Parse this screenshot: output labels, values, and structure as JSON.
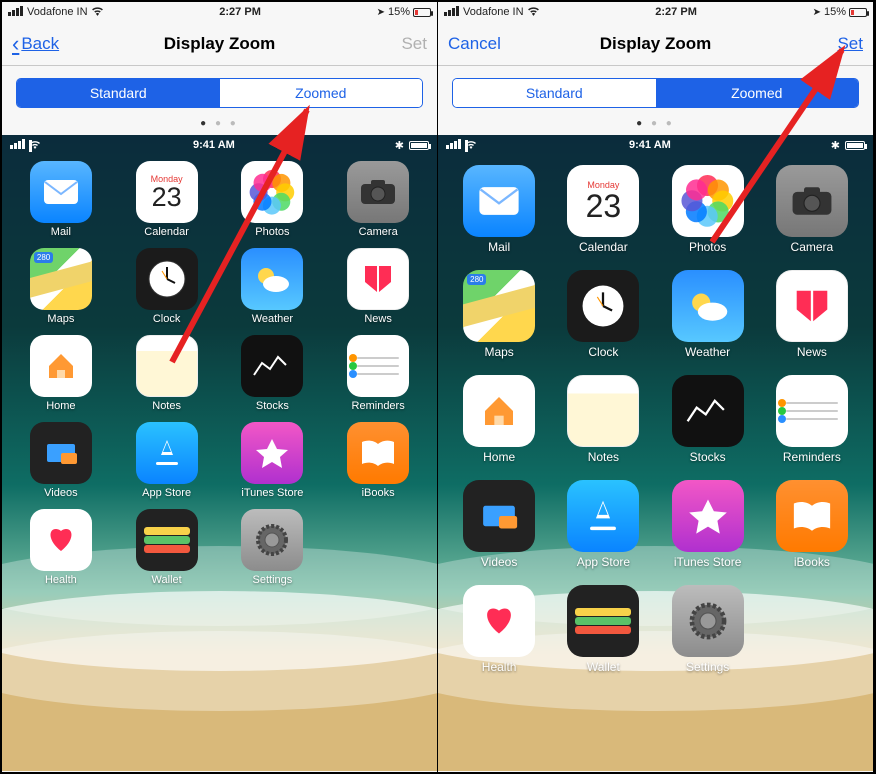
{
  "outer_status": {
    "carrier": "Vodafone IN",
    "time": "2:27 PM",
    "battery_pct": "15%"
  },
  "left": {
    "nav_back": "Back",
    "nav_title": "Display Zoom",
    "nav_set": "Set",
    "seg_standard": "Standard",
    "seg_zoomed": "Zoomed",
    "active_segment": "standard"
  },
  "right": {
    "nav_cancel": "Cancel",
    "nav_title": "Display Zoom",
    "nav_set": "Set",
    "seg_standard": "Standard",
    "seg_zoomed": "Zoomed",
    "active_segment": "zoomed"
  },
  "preview": {
    "time": "9:41 AM",
    "cal_dow": "Monday",
    "cal_dom": "23",
    "maps_badge": "280"
  },
  "apps": {
    "mail": "Mail",
    "calendar": "Calendar",
    "photos": "Photos",
    "camera": "Camera",
    "maps": "Maps",
    "clock": "Clock",
    "weather": "Weather",
    "news": "News",
    "home": "Home",
    "notes": "Notes",
    "stocks": "Stocks",
    "reminders": "Reminders",
    "videos": "Videos",
    "appstore": "App Store",
    "itunes": "iTunes Store",
    "ibooks": "iBooks",
    "health": "Health",
    "wallet": "Wallet",
    "settings": "Settings"
  }
}
